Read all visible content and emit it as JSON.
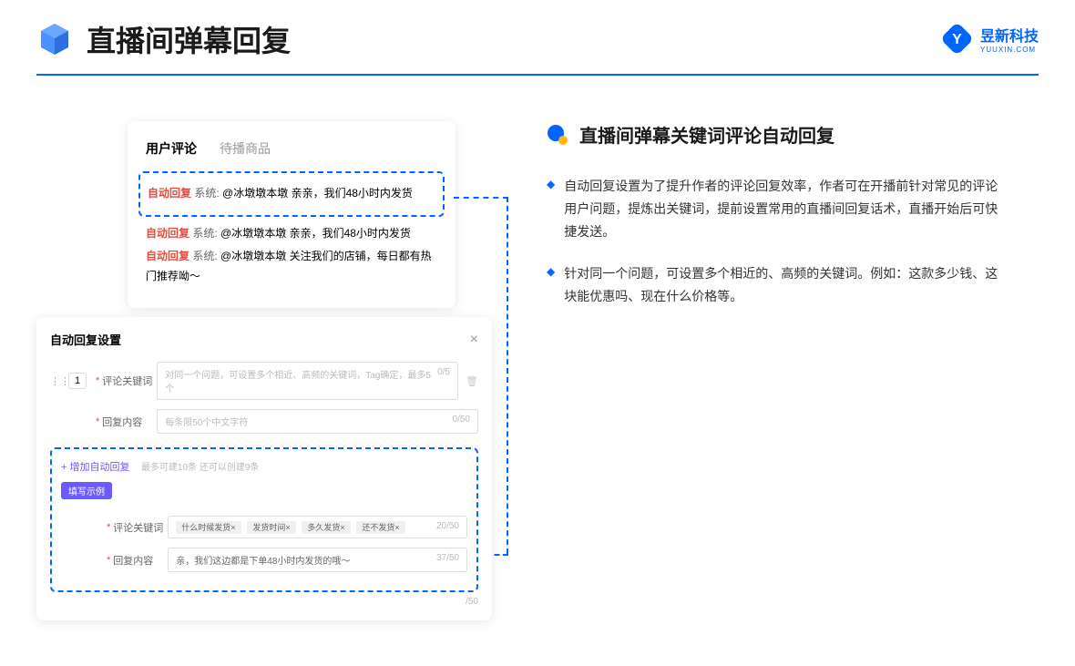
{
  "header": {
    "title": "直播间弹幕回复"
  },
  "logo": {
    "name": "昱新科技",
    "sub": "YUUXIN.COM"
  },
  "card1": {
    "tab_active": "用户评论",
    "tab_inactive": "待播商品",
    "auto": "自动回复",
    "sys": "系统:",
    "line1": "@冰墩墩本墩 亲亲，我们48小时内发货",
    "line2": "@冰墩墩本墩 亲亲，我们48小时内发货",
    "line3": "@冰墩墩本墩 关注我们的店铺，每日都有热门推荐呦～"
  },
  "card2": {
    "title": "自动回复设置",
    "idx": "1",
    "label1": "评论关键词",
    "placeholder1": "对同一个问题，可设置多个相近、高频的关键词，Tag确定，最多5个",
    "count1": "0/5",
    "label2": "回复内容",
    "placeholder2": "每条限50个中文字符",
    "count2": "0/50",
    "add_link": "+ 增加自动回复",
    "add_hint": "最多可建10条 还可以创建9条",
    "example_badge": "填写示例",
    "ex_label1": "评论关键词",
    "tag1": "什么时候发货×",
    "tag2": "发货时间×",
    "tag3": "多久发货×",
    "tag4": "还不发货×",
    "ex_count1": "20/50",
    "ex_label2": "回复内容",
    "ex_value2": "亲，我们这边都是下单48小时内发货的哦～",
    "ex_count2": "37/50",
    "footer_count": "/50"
  },
  "section": {
    "title": "直播间弹幕关键词评论自动回复",
    "bullet1": "自动回复设置为了提升作者的评论回复效率，作者可在开播前针对常见的评论用户问题，提炼出关键词，提前设置常用的直播间回复话术，直播开始后可快捷发送。",
    "bullet2": "针对同一个问题，可设置多个相近的、高频的关键词。例如：这款多少钱、这块能优惠吗、现在什么价格等。"
  }
}
